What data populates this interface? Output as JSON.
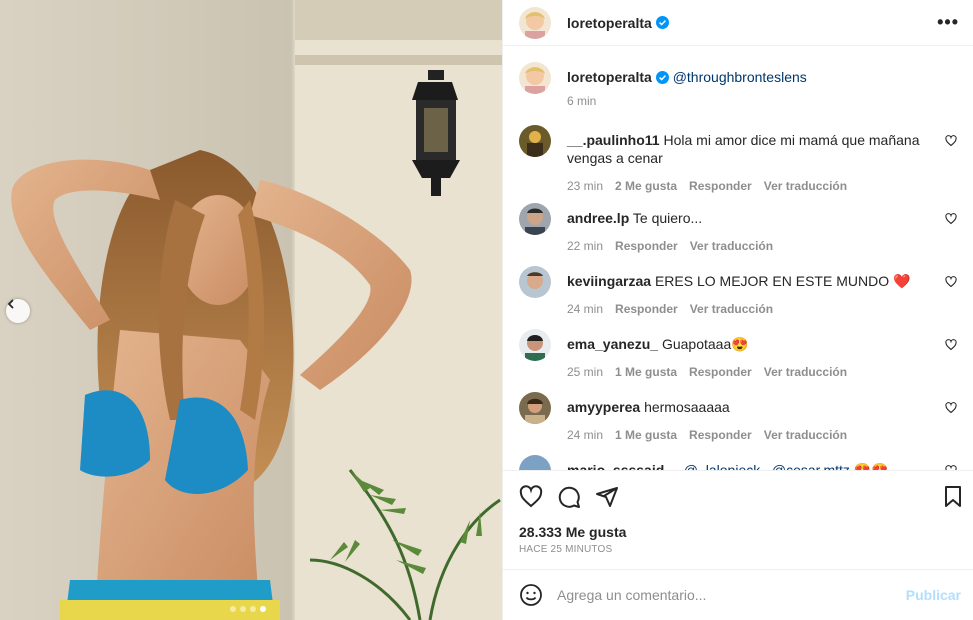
{
  "post": {
    "author": "loretoperalta",
    "more_icon": "more-horizontal-icon"
  },
  "caption": {
    "author": "loretoperalta",
    "text": "@throughbronteslens",
    "time": "6 min"
  },
  "comments": [
    {
      "user": "__.paulinho11",
      "text": "Hola mi amor dice mi mamá que mañana vengas a cenar",
      "time": "23 min",
      "likes": "2 Me gusta",
      "reply": "Responder",
      "translate": "Ver traducción"
    },
    {
      "user": "andree.lp",
      "text": "Te quiero...",
      "time": "22 min",
      "likes": "",
      "reply": "Responder",
      "translate": "Ver traducción"
    },
    {
      "user": "keviingarzaa",
      "text": "ERES LO MEJOR EN ESTE MUNDO ❤️",
      "time": "24 min",
      "likes": "",
      "reply": "Responder",
      "translate": "Ver traducción"
    },
    {
      "user": "ema_yanezu_",
      "text": "Guapotaaa😍",
      "time": "25 min",
      "likes": "1 Me gusta",
      "reply": "Responder",
      "translate": "Ver traducción"
    },
    {
      "user": "amyyperea",
      "text": "hermosaaaaa",
      "time": "24 min",
      "likes": "1 Me gusta",
      "reply": "Responder",
      "translate": "Ver traducción"
    },
    {
      "user": "mario_ssssaid__",
      "text": "@_lalopieck_ @cesar.mttz 😍😍",
      "time": "",
      "likes": "",
      "reply": "",
      "translate": ""
    }
  ],
  "footer": {
    "likes": "28.333 Me gusta",
    "ago": "HACE 25 MINUTOS",
    "comment_placeholder": "Agrega un comentario...",
    "publish": "Publicar"
  },
  "colors": {
    "verified": "#0095f6",
    "heart_emoji": "#ed4956",
    "publish_disabled": "#b2dffc"
  }
}
